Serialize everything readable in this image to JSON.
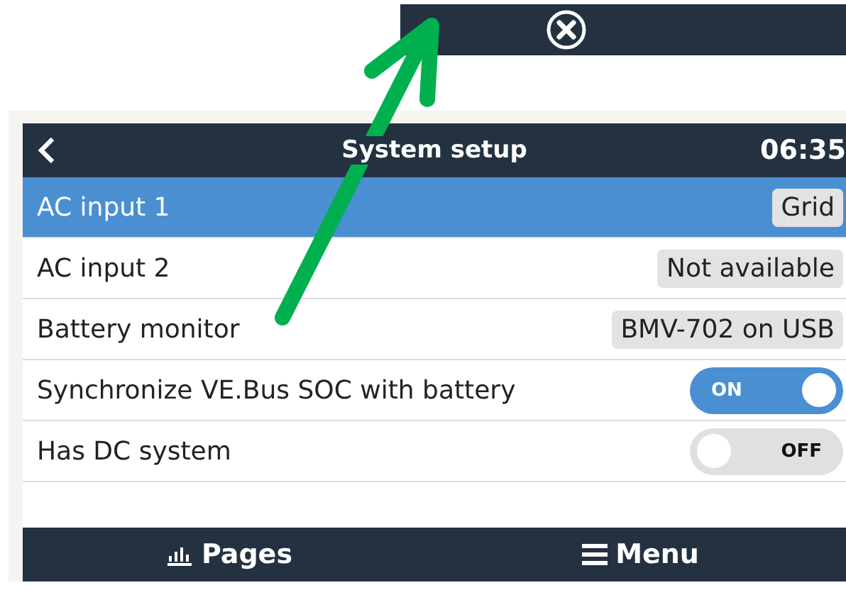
{
  "header": {
    "title": "System setup",
    "time": "06:35"
  },
  "rows": [
    {
      "kind": "value",
      "label": "AC input 1",
      "value": "Grid",
      "selected": true
    },
    {
      "kind": "value",
      "label": "AC input 2",
      "value": "Not available",
      "selected": false
    },
    {
      "kind": "value",
      "label": "Battery monitor",
      "value": "BMV-702 on USB",
      "selected": false
    },
    {
      "kind": "toggle",
      "label": "Synchronize VE.Bus SOC with battery",
      "on": true,
      "state_text": "ON",
      "selected": false
    },
    {
      "kind": "toggle",
      "label": "Has DC system",
      "on": false,
      "state_text": "OFF",
      "selected": false
    }
  ],
  "footer": {
    "left": "Pages",
    "right": "Menu"
  }
}
